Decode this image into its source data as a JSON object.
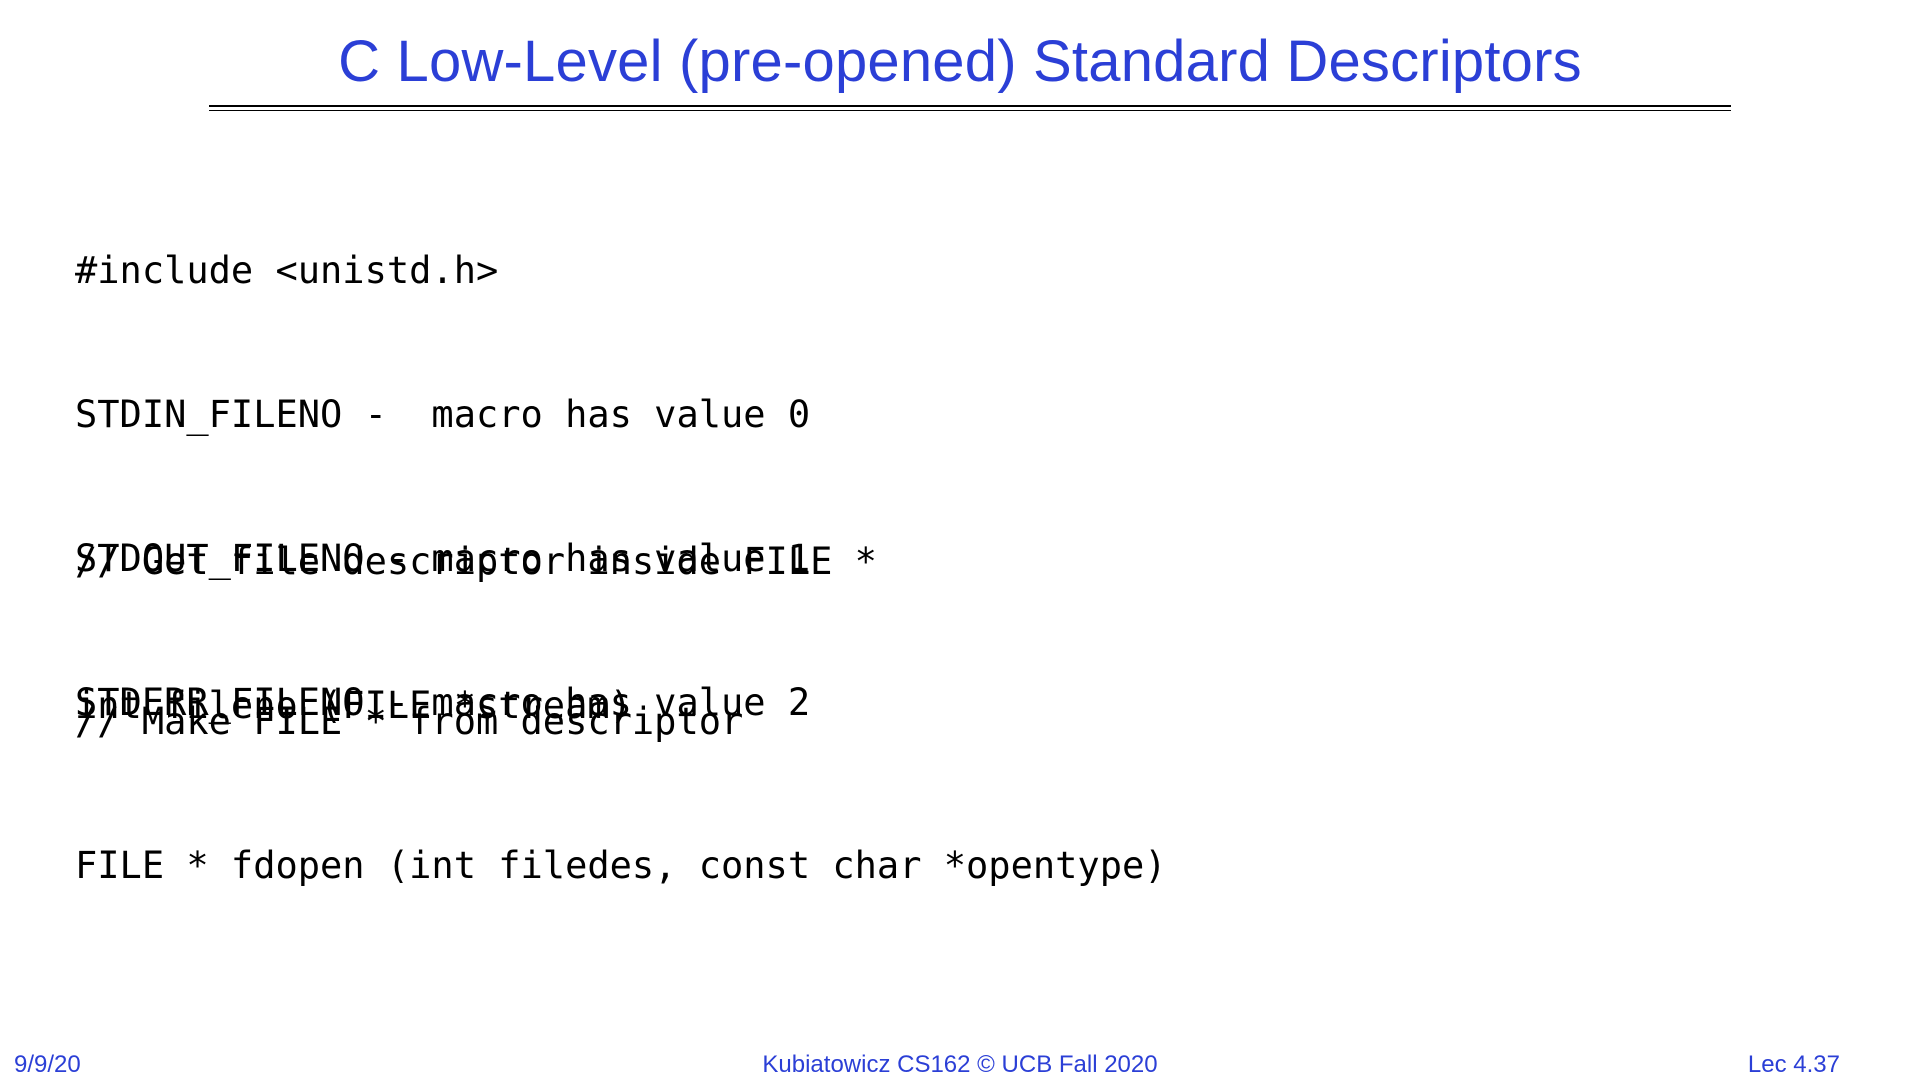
{
  "slide": {
    "title": "C Low-Level (pre-opened) Standard Descriptors",
    "title_color": "#2b3fd6",
    "code_sections": {
      "includes": [
        "#include <unistd.h>",
        "STDIN_FILENO -  macro has value 0",
        "STDOUT_FILENO - macro has value 1",
        "STDERR_FILENO - macro has value 2"
      ],
      "fileno": [
        "// Get file descriptor inside FILE *",
        "int fileno (FILE *stream)"
      ],
      "fdopen": [
        "// Make FILE * from descriptor",
        "FILE * fdopen (int filedes, const char *opentype)"
      ]
    },
    "footer": {
      "date": "9/9/20",
      "center": "Kubiatowicz CS162 © UCB Fall 2020",
      "lecture": "Lec 4.37"
    }
  }
}
